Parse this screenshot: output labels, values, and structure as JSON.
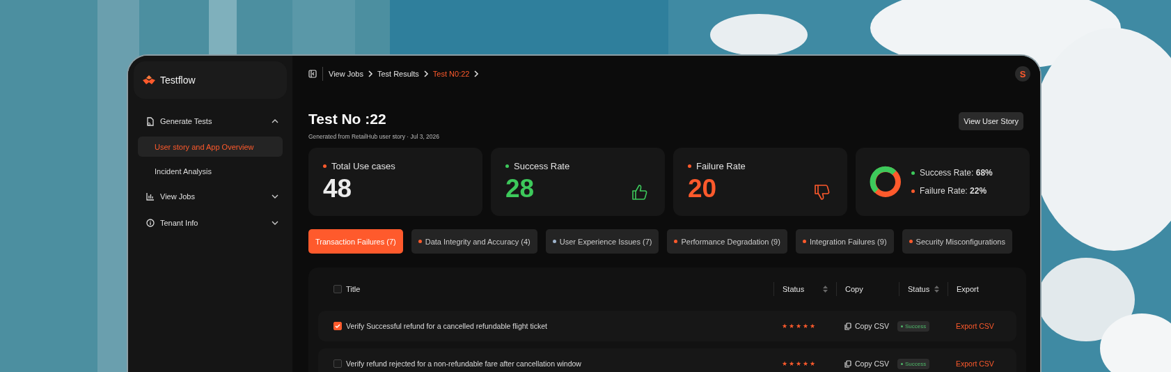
{
  "sidebar": {
    "logo": "Testflow",
    "items": [
      {
        "label": "Generate Tests",
        "expanded": true,
        "children": [
          {
            "label": "User story and App Overview",
            "selected": true
          },
          {
            "label": "Incident Analysis",
            "selected": false
          }
        ]
      },
      {
        "label": "View Jobs",
        "expanded": false
      },
      {
        "label": "Tenant Info",
        "expanded": false
      }
    ]
  },
  "breadcrumb": [
    {
      "label": "View Jobs",
      "current": false
    },
    {
      "label": "Test Results",
      "current": false
    },
    {
      "label": "Test N0:22",
      "current": true
    }
  ],
  "avatar": "S",
  "page": {
    "title": "Test No :22",
    "subtitle": "Generated from RetailHub user story · Jul 3, 2026",
    "action": "View User Story"
  },
  "stats": [
    {
      "kind": "total",
      "label": "Total Use cases",
      "value": "48",
      "color": "#ff5a2c"
    },
    {
      "kind": "success",
      "label": "Success Rate",
      "value": "28",
      "color": "#3dc95b"
    },
    {
      "kind": "failure",
      "label": "Failure Rate",
      "value": "20",
      "color": "#ff5a2c"
    }
  ],
  "summary": [
    {
      "label": "Success Rate: **68%**",
      "color": "#3dc95b"
    },
    {
      "label": "Failure Rate: **22%**",
      "color": "#ff5a2c"
    }
  ],
  "tabs": [
    {
      "label": "Transaction Failures (7)",
      "selected": true
    },
    {
      "label": "Data Integrity and Accuracy (4)",
      "selected": false,
      "color": "#ff5a2c"
    },
    {
      "label": "User Experience Issues (7)",
      "selected": false,
      "color": "#9fb4cc"
    },
    {
      "label": "Performance Degradation (9)",
      "selected": false,
      "color": "#ff5a2c"
    },
    {
      "label": "Integration Failures (9)",
      "selected": false,
      "color": "#ff5a2c"
    },
    {
      "label": "Security Misconfigurations",
      "selected": false,
      "color": "#ff5a2c"
    }
  ],
  "table": {
    "all_checked": false,
    "columns": [
      {
        "label": "Title",
        "sortable": false
      },
      {
        "label": "Status",
        "sortable": true
      },
      {
        "label": "Copy",
        "sortable": false
      },
      {
        "label": "Status",
        "sortable": true
      },
      {
        "label": "Export",
        "sortable": false
      }
    ],
    "rows": [
      {
        "checked": true,
        "title": "Verify Successful refund for a cancelled refundable flight ticket",
        "stars": 5,
        "copy": "Copy CSV",
        "status": "Success",
        "export": "Export CSV"
      },
      {
        "checked": false,
        "title": "Verify refund rejected for a non-refundable fare after cancellation window",
        "stars": 5,
        "copy": "Copy CSV",
        "status": "Success",
        "export": "Export CSV"
      }
    ]
  }
}
